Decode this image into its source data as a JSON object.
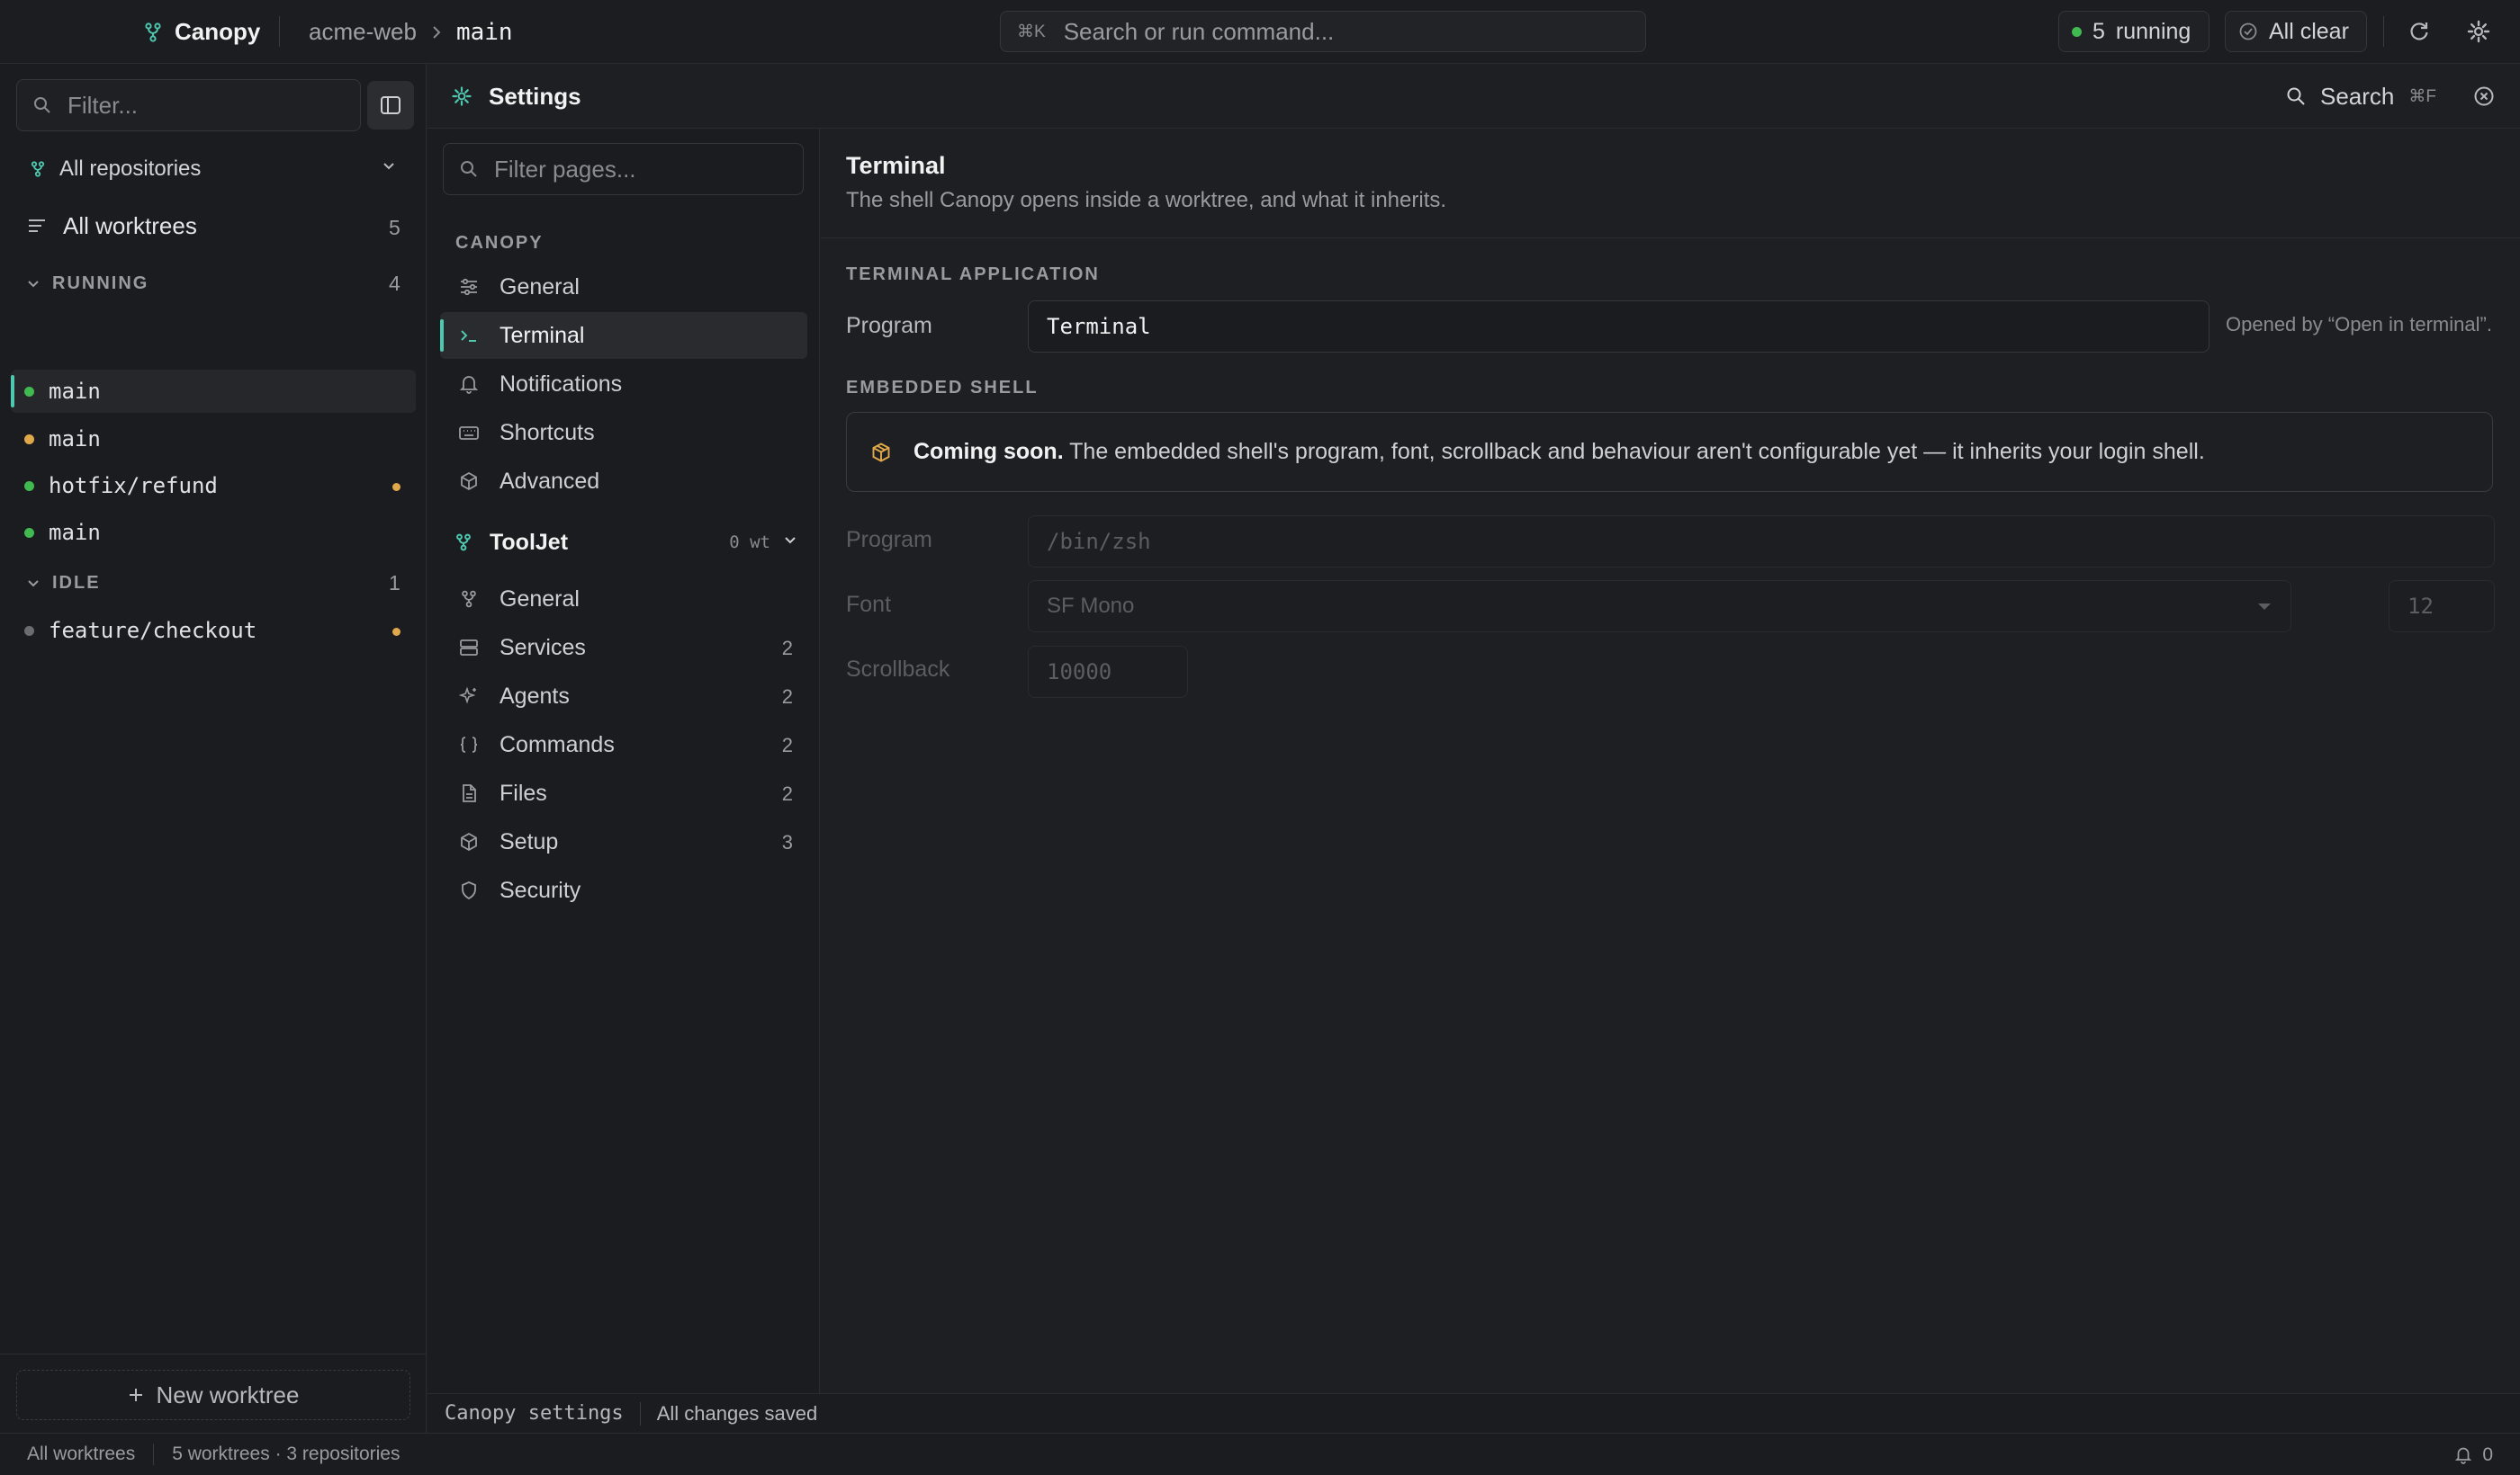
{
  "topbar": {
    "app_name": "Canopy",
    "breadcrumb": {
      "repo": "acme-web",
      "branch": "main"
    },
    "command": {
      "shortcut": "⌘K",
      "placeholder": "Search or run command..."
    },
    "running_count": "5",
    "running_label": "running",
    "all_clear": "All clear"
  },
  "sidebar": {
    "filter_placeholder": "Filter...",
    "repo_select": "All repositories",
    "all_worktrees": {
      "label": "All worktrees",
      "count": "5"
    },
    "groups": [
      {
        "label": "RUNNING",
        "count": "4",
        "items": [
          {
            "name": "main",
            "status": "running",
            "status_color": "#3fb950",
            "active": true,
            "modified": false
          },
          {
            "name": "main",
            "status": "warning",
            "status_color": "#e0a84a",
            "active": false,
            "modified": false
          },
          {
            "name": "hotfix/refund",
            "status": "running",
            "status_color": "#3fb950",
            "active": false,
            "modified": true
          },
          {
            "name": "main",
            "status": "running",
            "status_color": "#3fb950",
            "active": false,
            "modified": false
          }
        ]
      },
      {
        "label": "IDLE",
        "count": "1",
        "items": [
          {
            "name": "feature/checkout",
            "status": "idle",
            "status_color": "#6b6c70",
            "active": false,
            "modified": true
          }
        ]
      }
    ],
    "new_worktree": "New worktree"
  },
  "settings_header": {
    "title": "Settings",
    "search_label": "Search",
    "search_shortcut": "⌘F"
  },
  "settings_nav": {
    "filter_placeholder": "Filter pages...",
    "section_label": "CANOPY",
    "canopy_items": [
      {
        "label": "General",
        "icon": "sliders-icon",
        "active": false
      },
      {
        "label": "Terminal",
        "icon": "terminal-icon",
        "active": true
      },
      {
        "label": "Notifications",
        "icon": "bell-icon",
        "active": false
      },
      {
        "label": "Shortcuts",
        "icon": "keyboard-icon",
        "active": false
      },
      {
        "label": "Advanced",
        "icon": "cube-icon",
        "active": false
      }
    ],
    "project": {
      "name": "ToolJet",
      "worktrees": "0 wt"
    },
    "project_items": [
      {
        "label": "General",
        "icon": "branch-icon",
        "count": ""
      },
      {
        "label": "Services",
        "icon": "server-icon",
        "count": "2"
      },
      {
        "label": "Agents",
        "icon": "sparkle-icon",
        "count": "2"
      },
      {
        "label": "Commands",
        "icon": "braces-icon",
        "count": "2"
      },
      {
        "label": "Files",
        "icon": "file-icon",
        "count": "2"
      },
      {
        "label": "Setup",
        "icon": "box-icon",
        "count": "3"
      },
      {
        "label": "Security",
        "icon": "shield-icon",
        "count": ""
      }
    ]
  },
  "content": {
    "title": "Terminal",
    "subtitle": "The shell Canopy opens inside a worktree, and what it inherits.",
    "terminal_app": {
      "section": "TERMINAL APPLICATION",
      "program_label": "Program",
      "program_value": "Terminal",
      "program_hint": "Opened by “Open in terminal”."
    },
    "embedded": {
      "section": "EMBEDDED SHELL",
      "notice_bold": "Coming soon.",
      "notice_text": "The embedded shell's program, font, scrollback and behaviour aren't configurable yet — it inherits your login shell.",
      "program_label": "Program",
      "program_placeholder": "/bin/zsh",
      "font_label": "Font",
      "font_value": "SF Mono",
      "font_size": "12",
      "scrollback_label": "Scrollback",
      "scrollback_value": "10000"
    }
  },
  "content_footer": {
    "scope": "Canopy settings",
    "status": "All changes saved"
  },
  "statusbar": {
    "view": "All worktrees",
    "summary": "5 worktrees · 3 repositories",
    "notifications": "0"
  },
  "colors": {
    "accent": "#4ec9b0",
    "running": "#3fb950",
    "warning": "#e0a84a",
    "notice_icon": "#e0a84a"
  }
}
